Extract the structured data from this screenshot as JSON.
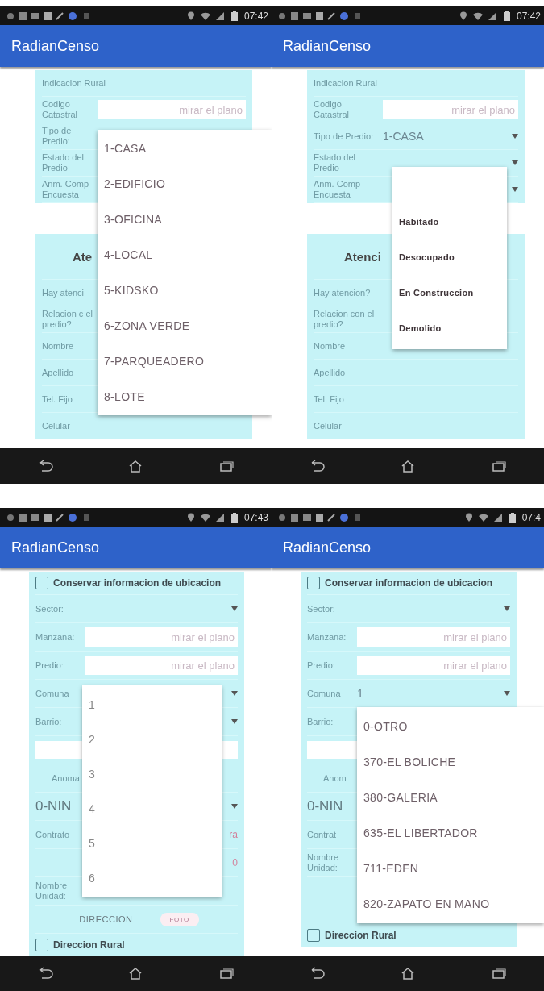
{
  "screens": [
    {
      "status_time": "07:42",
      "title": "RadianCenso",
      "form": [
        {
          "kind": "label",
          "label": "Indicacion Rural"
        },
        {
          "kind": "field",
          "label": "Codigo Catastral",
          "placeholder": "mirar el plano"
        },
        {
          "kind": "select",
          "label": "Tipo de Predio:",
          "dropdown_arrow": false
        },
        {
          "kind": "select",
          "label": "Estado del Predio",
          "dropdown_arrow": false
        },
        {
          "kind": "select",
          "label": "Anm. Comp Encuesta",
          "dropdown_arrow": false
        },
        {
          "kind": "heading",
          "text": "Ate"
        },
        {
          "kind": "label",
          "label": "Hay atenci"
        },
        {
          "kind": "label",
          "label": "Relacion c el predio?"
        },
        {
          "kind": "label",
          "label": "Nombre"
        },
        {
          "kind": "label",
          "label": "Apellido"
        },
        {
          "kind": "label",
          "label": "Tel. Fijo"
        },
        {
          "kind": "label",
          "label": "Celular"
        }
      ],
      "popup": [
        {
          "label": "1-CASA"
        },
        {
          "label": "2-EDIFICIO"
        },
        {
          "label": "3-OFICINA"
        },
        {
          "label": "4-LOCAL"
        },
        {
          "label": "5-KIDSKO"
        },
        {
          "label": "6-ZONA VERDE"
        },
        {
          "label": "7-PARQUEADERO"
        },
        {
          "label": "8-LOTE"
        }
      ]
    },
    {
      "status_time": "07:42",
      "title": "RadianCenso",
      "form": [
        {
          "kind": "label",
          "label": "Indicacion Rural"
        },
        {
          "kind": "field",
          "label": "Codigo Catastral",
          "placeholder": "mirar el plano"
        },
        {
          "kind": "select",
          "label": "Tipo de Predio:",
          "value": "1-CASA",
          "dropdown_arrow": true
        },
        {
          "kind": "select",
          "label": "Estado del Predio",
          "dropdown_arrow": true
        },
        {
          "kind": "select",
          "label": "Anm. Comp Encuesta",
          "dropdown_arrow": true
        },
        {
          "kind": "heading",
          "text": "Atenci"
        },
        {
          "kind": "label",
          "label": "Hay atencion?"
        },
        {
          "kind": "label",
          "label": "Relacion con el predio?"
        },
        {
          "kind": "label",
          "label": "Nombre"
        },
        {
          "kind": "label",
          "label": "Apellido"
        },
        {
          "kind": "label",
          "label": "Tel. Fijo"
        },
        {
          "kind": "label",
          "label": "Celular"
        }
      ],
      "popup": [
        {
          "label": "Habitado"
        },
        {
          "label": "Desocupado"
        },
        {
          "label": "En Construccion"
        },
        {
          "label": "Demolido"
        }
      ]
    },
    {
      "status_time": "07:43",
      "title": "RadianCenso",
      "form": [
        {
          "kind": "checkbox",
          "label": "Conservar informacion de ubicacion",
          "checked": false
        },
        {
          "kind": "select",
          "label": "Sector:",
          "dropdown_arrow": true
        },
        {
          "kind": "field",
          "label": "Manzana:",
          "placeholder": "mirar el plano"
        },
        {
          "kind": "field",
          "label": "Predio:",
          "placeholder": "mirar el plano"
        },
        {
          "kind": "select",
          "label": "Comuna",
          "dropdown_arrow": true
        },
        {
          "kind": "select",
          "label": "Barrio:",
          "dropdown_arrow": true
        },
        {
          "kind": "input"
        },
        {
          "kind": "caption",
          "text": "Anoma"
        },
        {
          "kind": "select",
          "value": "0-NIN",
          "dropdown_arrow": true
        },
        {
          "kind": "pair",
          "label": "Contrato",
          "value": "ra"
        },
        {
          "kind": "pair",
          "value": "0"
        },
        {
          "kind": "label",
          "label": "Nombre Unidad:"
        },
        {
          "kind": "buttons",
          "buttons": [
            {
              "kind": "plain",
              "label": "DIRECCION"
            },
            {
              "kind": "pill",
              "label": "FOTO"
            }
          ]
        },
        {
          "kind": "checkbox",
          "label": "Direccion Rural",
          "checked": false
        }
      ],
      "popup": [
        {
          "label": "1"
        },
        {
          "label": "2"
        },
        {
          "label": "3"
        },
        {
          "label": "4"
        },
        {
          "label": "5"
        },
        {
          "label": "6"
        }
      ]
    },
    {
      "status_time": "07:4",
      "title": "RadianCenso",
      "form": [
        {
          "kind": "checkbox",
          "label": "Conservar informacion de ubicacion",
          "checked": false
        },
        {
          "kind": "select",
          "label": "Sector:",
          "dropdown_arrow": true
        },
        {
          "kind": "field",
          "label": "Manzana:",
          "placeholder": "mirar el plano"
        },
        {
          "kind": "field",
          "label": "Predio:",
          "placeholder": "mirar el plano"
        },
        {
          "kind": "select",
          "label": "Comuna",
          "value": "1",
          "dropdown_arrow": true
        },
        {
          "kind": "select",
          "label": "Barrio:",
          "dropdown_arrow": false
        },
        {
          "kind": "input"
        },
        {
          "kind": "caption",
          "text": "Anom"
        },
        {
          "kind": "select",
          "value": "0-NIN",
          "dropdown_arrow": false
        },
        {
          "kind": "pair",
          "label": "Contrat"
        },
        {
          "kind": "label",
          "label": "Nombre Unidad:"
        },
        {
          "kind": "checkbox",
          "label": "Direccion Rural",
          "checked": false
        }
      ],
      "popup": [
        {
          "label": "0-OTRO"
        },
        {
          "label": "370-EL BOLICHE"
        },
        {
          "label": "380-GALERIA"
        },
        {
          "label": "635-EL LIBERTADOR"
        },
        {
          "label": "711-EDEN"
        },
        {
          "label": "820-ZAPATO EN MANO"
        }
      ]
    }
  ]
}
